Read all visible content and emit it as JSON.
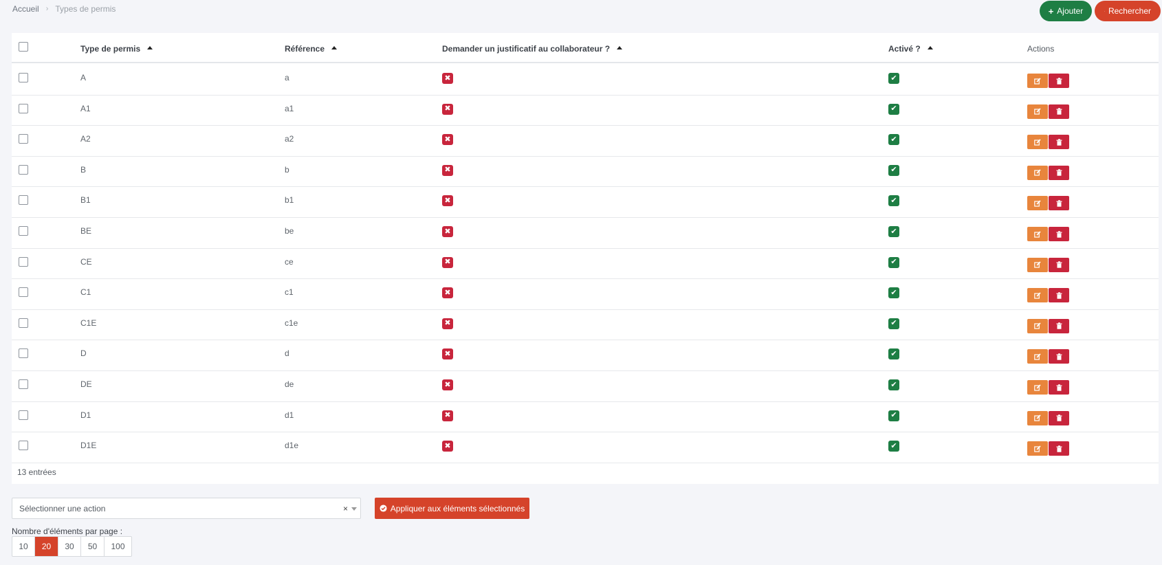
{
  "breadcrumb": {
    "home": "Accueil",
    "separator": "›",
    "current": "Types de permis"
  },
  "top_actions": {
    "add_label": "Ajouter",
    "add_icon": "+",
    "search_label": "Rechercher"
  },
  "table": {
    "columns": {
      "type": "Type de permis",
      "reference": "Référence",
      "justificatif": "Demander un justificatif au collaborateur ?",
      "active": "Activé ?",
      "actions": "Actions"
    },
    "rows": [
      {
        "type": "A",
        "ref": "a",
        "justificatif": false,
        "active": true
      },
      {
        "type": "A1",
        "ref": "a1",
        "justificatif": false,
        "active": true
      },
      {
        "type": "A2",
        "ref": "a2",
        "justificatif": false,
        "active": true
      },
      {
        "type": "B",
        "ref": "b",
        "justificatif": false,
        "active": true
      },
      {
        "type": "B1",
        "ref": "b1",
        "justificatif": false,
        "active": true
      },
      {
        "type": "BE",
        "ref": "be",
        "justificatif": false,
        "active": true
      },
      {
        "type": "CE",
        "ref": "ce",
        "justificatif": false,
        "active": true
      },
      {
        "type": "C1",
        "ref": "c1",
        "justificatif": false,
        "active": true
      },
      {
        "type": "C1E",
        "ref": "c1e",
        "justificatif": false,
        "active": true
      },
      {
        "type": "D",
        "ref": "d",
        "justificatif": false,
        "active": true
      },
      {
        "type": "DE",
        "ref": "de",
        "justificatif": false,
        "active": true
      },
      {
        "type": "D1",
        "ref": "d1",
        "justificatif": false,
        "active": true
      },
      {
        "type": "D1E",
        "ref": "d1e",
        "justificatif": false,
        "active": true
      }
    ],
    "count_text": "13 entrées"
  },
  "bulk": {
    "placeholder": "Sélectionner une action",
    "clear": "×",
    "apply_label": "Appliquer aux éléments sélectionnés"
  },
  "pagination": {
    "label": "Nombre d'éléments par page :",
    "options": [
      "10",
      "20",
      "30",
      "50",
      "100"
    ],
    "selected": "20"
  },
  "colors": {
    "green": "#1e7e44",
    "red": "#c8253c",
    "orange_red": "#d5432a",
    "orange": "#e8853c"
  }
}
